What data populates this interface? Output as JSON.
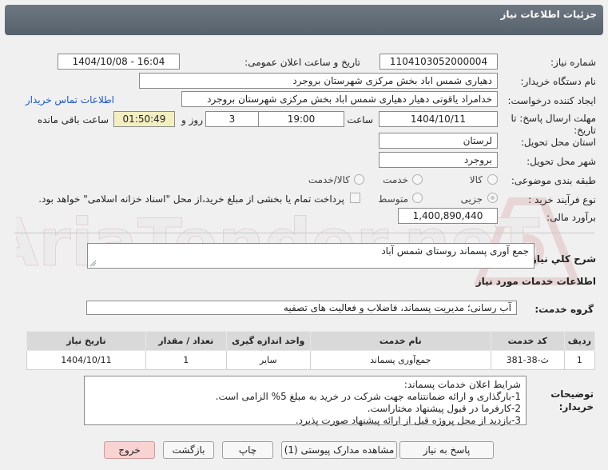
{
  "header": {
    "title": "جزئیات اطلاعات نیاز"
  },
  "form": {
    "need_number_label": "شماره نیاز:",
    "need_number": "1104103052000004",
    "announce_label": "تاریخ و ساعت اعلان عمومی:",
    "announce_value": "1404/10/08 - 16:04",
    "buyer_org_label": "نام دستگاه خریدار:",
    "buyer_org": "دهیاری شمس اباد بخش مرکزی شهرستان بروجرد",
    "creator_label": "ایجاد کننده درخواست:",
    "creator": "خدامراد یاقوتی دهیار دهیاری شمس اباد بخش مرکزی شهرستان بروجرد",
    "contact_link": "اطلاعات تماس خریدار",
    "deadline_label_1": "مهلت ارسال پاسخ: تا",
    "deadline_label_2": "تاریخ:",
    "deadline_date": "1404/10/11",
    "time_label": "ساعت",
    "deadline_time": "19:00",
    "days_value": "3",
    "days_label": "روز و",
    "remaining_time": "01:50:49",
    "remaining_label": "ساعت باقی مانده",
    "province_label": "استان محل تحویل:",
    "province": "لرستان",
    "city_label": "شهر محل تحویل:",
    "city": "بروجرد",
    "category_label": "طبقه بندی موضوعی:",
    "category_options": [
      "کالا",
      "خدمت",
      "کالا/خدمت"
    ],
    "process_label": "نوع فرآیند خرید :",
    "process_options": [
      "جزیی",
      "متوسط"
    ],
    "payment_note": "پرداخت تمام یا بخشی از مبلغ خرید،از محل \"اسناد خزانه اسلامی\" خواهد بود.",
    "estimate_label": "برآورد مالی:",
    "estimate": "1,400,890,440"
  },
  "summary": {
    "label": "شرح کلي نياز:",
    "value": "جمع آوری پسماند روستای شمس آباد"
  },
  "services": {
    "section_title": "اطلاعات خدمات مورد نیاز",
    "group_label": "گروه خدمت:",
    "group_value": "آب رسانی؛ مدیریت پسماند، فاضلاب و فعالیت های تصفیه"
  },
  "table": {
    "headers": [
      "ردیف",
      "کد خدمت",
      "نام خدمت",
      "واحد اندازه گیری",
      "تعداد / مقدار",
      "تاریخ نیاز"
    ],
    "rows": [
      [
        "1",
        "ث-38-381",
        "جمع‌آوری پسماند",
        "سایر",
        "1",
        "1404/10/11"
      ]
    ]
  },
  "buyer_notes": {
    "label_1": "توضیحات",
    "label_2": "خریدار:",
    "lines": [
      "شرایط اعلان خدمات پسماند:",
      "1-بارگذاری و ارائه ضمانتنامه جهت شرکت در خرید به مبلغ 5% الزامی است.",
      "2-کارفرما در قبول پیشنهاد مختاراست.",
      "3-بازدید از محل پروژه قبل از ارائه پیشنهاد صورت پذیرد."
    ]
  },
  "buttons": {
    "reply": "پاسخ به نیاز",
    "attachments": "مشاهده مدارک پیوستی (1)",
    "print": "چاپ",
    "back": "بازگشت",
    "exit": "خروج"
  },
  "colors": {
    "header_bg": "#5f6973",
    "remaining_bg": "#f4efc0",
    "link": "#1a56c8",
    "exit_button": "#f9d2d2"
  }
}
